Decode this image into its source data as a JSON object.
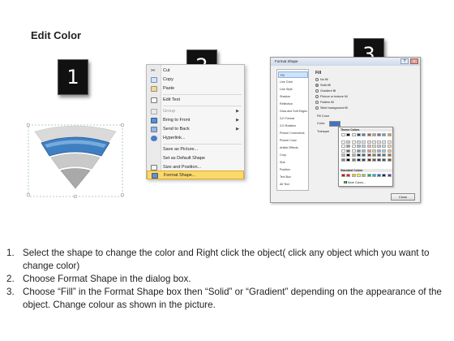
{
  "page": {
    "title": "Edit Color"
  },
  "badges": [
    "1",
    "2",
    "3"
  ],
  "shape": {
    "accent": "#3f7fc2",
    "gray_light": "#d2d2d2",
    "gray_dark": "#a8a8a8"
  },
  "context_menu": {
    "items": [
      {
        "label": "Cut",
        "icon": "scissors-icon"
      },
      {
        "label": "Copy",
        "icon": "copy-icon"
      },
      {
        "label": "Paste",
        "icon": "paste-icon"
      },
      {
        "label": "Edit Text",
        "icon": "edit-text-icon"
      },
      {
        "label": "Group",
        "icon": "group-icon",
        "disabled": true,
        "submenu": true
      },
      {
        "label": "Bring to Front",
        "icon": "bring-front-icon",
        "submenu": true
      },
      {
        "label": "Send to Back",
        "icon": "send-back-icon",
        "submenu": true
      },
      {
        "label": "Hyperlink...",
        "icon": "hyperlink-icon"
      },
      {
        "label": "Save as Picture...",
        "icon": ""
      },
      {
        "label": "Set as Default Shape",
        "icon": ""
      },
      {
        "label": "Size and Position...",
        "icon": "size-icon"
      },
      {
        "label": "Format Shape...",
        "icon": "format-icon",
        "highlighted": true
      }
    ]
  },
  "dialog": {
    "title": "Format Shape",
    "nav": [
      "Fill",
      "Line Color",
      "Line Style",
      "Shadow",
      "Reflection",
      "Glow and Soft Edges",
      "3-D Format",
      "3-D Rotation",
      "Picture Corrections",
      "Picture Color",
      "Artistic Effects",
      "Crop",
      "Size",
      "Position",
      "Text Box",
      "Alt Text"
    ],
    "fill_heading": "Fill",
    "options": [
      "No fill",
      "Solid fill",
      "Gradient fill",
      "Picture or texture fill",
      "Pattern fill",
      "Slide background fill"
    ],
    "selected_option": 1,
    "fill_color_label": "Fill Color",
    "color_label": "Color:",
    "transparency_label": "Transpar",
    "theme_colors_label": "Theme Colors",
    "standard_colors_label": "Standard Colors",
    "more_colors": "More Colors...",
    "close": "Close",
    "theme_row": [
      "#ffffff",
      "#000000",
      "#eeece1",
      "#1f497d",
      "#4f81bd",
      "#c0504d",
      "#9bbb59",
      "#8064a2",
      "#4bacc6",
      "#f79646"
    ],
    "standard_row": [
      "#c00000",
      "#ff0000",
      "#ffc000",
      "#ffff00",
      "#92d050",
      "#00b050",
      "#00b0f0",
      "#0070c0",
      "#002060",
      "#7030a0"
    ]
  },
  "instructions": [
    {
      "num": "1.",
      "text": "Select the shape to change the color and Right click the object( click any object which you want to change color)"
    },
    {
      "num": "2.",
      "text": "Choose Format Shape in the dialog box."
    },
    {
      "num": "3.",
      "text": "Choose “Fill” in the Format Shape box then “Solid” or “Gradient” depending on the appearance of the object. Change colour as shown in the picture."
    }
  ]
}
